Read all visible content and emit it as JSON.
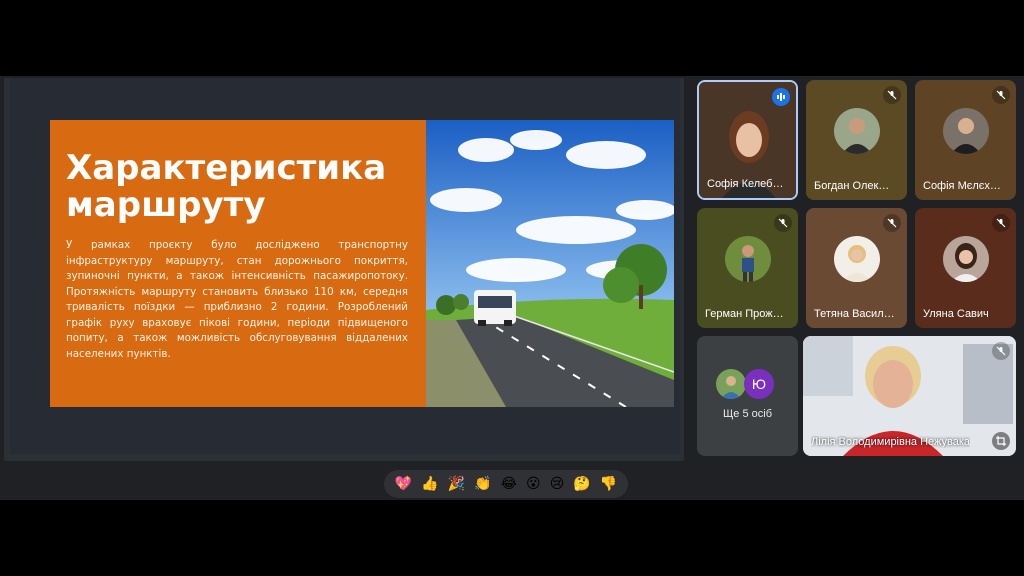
{
  "slide": {
    "title": "Характеристика маршруту",
    "body": "У рамках проєкту було досліджено транспортну інфраструктуру маршруту, стан дорожнього покриття, зупиночні пункти, а також інтенсивність пасажиропотоку. Протяжність маршруту становить близько 110 км, середня тривалість поїздки — приблизно 2 години. Розроблений графік руху враховує пікові години, періоди підвищеного попиту, а також можливість обслуговування віддалених населених пунктів."
  },
  "participants": [
    {
      "name": "Софія Келеб…",
      "status": "speaking"
    },
    {
      "name": "Богдан Олек…",
      "status": "muted"
    },
    {
      "name": "Софія Мєлєх…",
      "status": "muted"
    },
    {
      "name": "Герман Прож…",
      "status": "muted"
    },
    {
      "name": "Тетяна Васил…",
      "status": "muted"
    },
    {
      "name": "Уляна Савич",
      "status": "muted"
    }
  ],
  "others": {
    "label": "Ще 5 осіб",
    "initial": "Ю"
  },
  "pinned": {
    "name": "Лілія Володимирівна Нежувака"
  },
  "reactions": [
    {
      "icon": "sparkling-heart",
      "glyph": "💖"
    },
    {
      "icon": "thumbs-up",
      "glyph": "👍"
    },
    {
      "icon": "party-popper",
      "glyph": "🎉"
    },
    {
      "icon": "clapping-hands",
      "glyph": "👏"
    },
    {
      "icon": "tears-of-joy",
      "glyph": "😂"
    },
    {
      "icon": "surprised-face",
      "glyph": "😮"
    },
    {
      "icon": "crying-face",
      "glyph": "😢"
    },
    {
      "icon": "thinking-face",
      "glyph": "🤔"
    },
    {
      "icon": "thumbs-down",
      "glyph": "👎"
    }
  ],
  "colors": {
    "slide_accent": "#d86a12",
    "speaking_indicator": "#1a73e8",
    "background": "#202124"
  }
}
